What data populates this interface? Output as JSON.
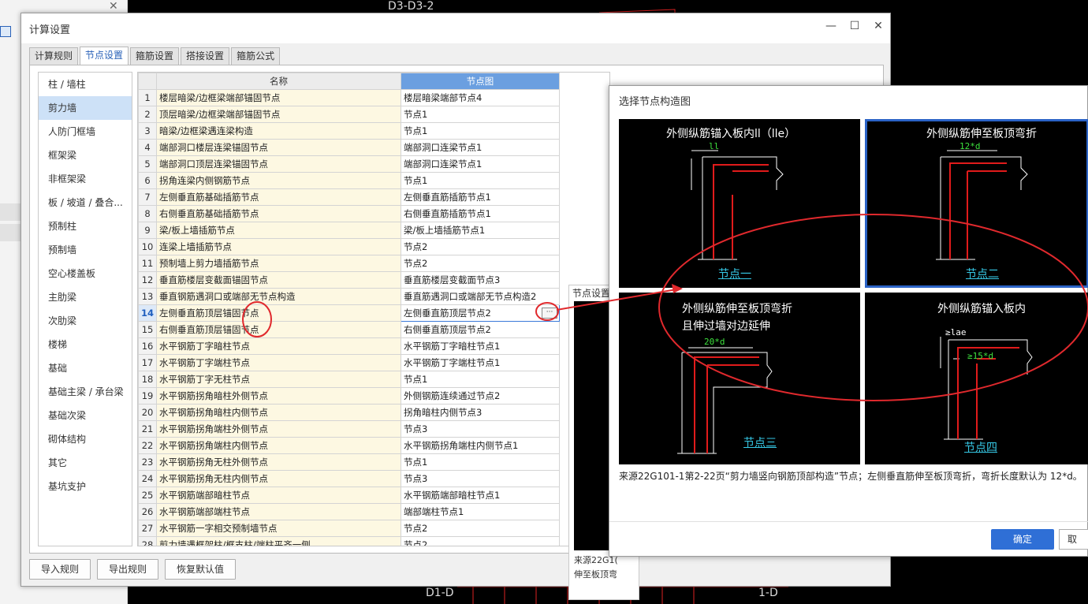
{
  "cad": {
    "label_top": "D3-D3-2",
    "label_bottom_left": "D1-D",
    "label_bottom_right": "1-D"
  },
  "main_dialog": {
    "title": "计算设置",
    "tabs": [
      "计算规则",
      "节点设置",
      "箍筋设置",
      "搭接设置",
      "箍筋公式"
    ],
    "active_tab": "节点设置",
    "categories": [
      "柱 / 墙柱",
      "剪力墙",
      "人防门框墙",
      "框架梁",
      "非框架梁",
      "板 / 坡道 / 叠合...",
      "预制柱",
      "预制墙",
      "空心楼盖板",
      "主肋梁",
      "次肋梁",
      "楼梯",
      "基础",
      "基础主梁 / 承台梁",
      "基础次梁",
      "砌体结构",
      "其它",
      "基坑支护"
    ],
    "selected_category": "剪力墙",
    "table": {
      "col_name": "名称",
      "col_diagram": "节点图",
      "rows": [
        {
          "no": "1",
          "name": "楼层暗梁/边框梁端部锚固节点",
          "value": "楼层暗梁端部节点4"
        },
        {
          "no": "2",
          "name": "顶层暗梁/边框梁端部锚固节点",
          "value": "节点1"
        },
        {
          "no": "3",
          "name": "暗梁/边框梁遇连梁构造",
          "value": "节点1"
        },
        {
          "no": "4",
          "name": "端部洞口楼层连梁锚固节点",
          "value": "端部洞口连梁节点1"
        },
        {
          "no": "5",
          "name": "端部洞口顶层连梁锚固节点",
          "value": "端部洞口连梁节点1"
        },
        {
          "no": "6",
          "name": "拐角连梁内侧钢筋节点",
          "value": "节点1"
        },
        {
          "no": "7",
          "name": "左侧垂直筋基础插筋节点",
          "value": "左侧垂直筋插筋节点1"
        },
        {
          "no": "8",
          "name": "右侧垂直筋基础插筋节点",
          "value": "右侧垂直筋插筋节点1"
        },
        {
          "no": "9",
          "name": "梁/板上墙插筋节点",
          "value": "梁/板上墙插筋节点1"
        },
        {
          "no": "10",
          "name": "连梁上墙插筋节点",
          "value": "节点2"
        },
        {
          "no": "11",
          "name": "预制墙上剪力墙插筋节点",
          "value": "节点2"
        },
        {
          "no": "12",
          "name": "垂直筋楼层变截面锚固节点",
          "value": "垂直筋楼层变截面节点3"
        },
        {
          "no": "13",
          "name": "垂直钢筋遇洞口或端部无节点构造",
          "value": "垂直筋遇洞口或端部无节点构造2"
        },
        {
          "no": "14",
          "name": "左侧垂直筋顶层锚固节点",
          "value": "左侧垂直筋顶层节点2"
        },
        {
          "no": "15",
          "name": "右侧垂直筋顶层锚固节点",
          "value": "右侧垂直筋顶层节点2"
        },
        {
          "no": "16",
          "name": "水平钢筋丁字暗柱节点",
          "value": "水平钢筋丁字暗柱节点1"
        },
        {
          "no": "17",
          "name": "水平钢筋丁字端柱节点",
          "value": "水平钢筋丁字端柱节点1"
        },
        {
          "no": "18",
          "name": "水平钢筋丁字无柱节点",
          "value": "节点1"
        },
        {
          "no": "19",
          "name": "水平钢筋拐角暗柱外侧节点",
          "value": "外侧钢筋连续通过节点2"
        },
        {
          "no": "20",
          "name": "水平钢筋拐角暗柱内侧节点",
          "value": "拐角暗柱内侧节点3"
        },
        {
          "no": "21",
          "name": "水平钢筋拐角端柱外侧节点",
          "value": "节点3"
        },
        {
          "no": "22",
          "name": "水平钢筋拐角端柱内侧节点",
          "value": "水平钢筋拐角端柱内侧节点1"
        },
        {
          "no": "23",
          "name": "水平钢筋拐角无柱外侧节点",
          "value": "节点1"
        },
        {
          "no": "24",
          "name": "水平钢筋拐角无柱内侧节点",
          "value": "节点3"
        },
        {
          "no": "25",
          "name": "水平钢筋端部暗柱节点",
          "value": "水平钢筋端部暗柱节点1"
        },
        {
          "no": "26",
          "name": "水平钢筋端部端柱节点",
          "value": "端部端柱节点1"
        },
        {
          "no": "27",
          "name": "水平钢筋一字相交预制墙节点",
          "value": "节点2"
        },
        {
          "no": "28",
          "name": "剪力墙遇框架柱/框支柱/端柱平齐一侧",
          "value": "节点2"
        }
      ],
      "current_row": "14",
      "ellipsis_label": "···"
    },
    "preview": {
      "header": "节点设置示",
      "footer_line1": "来源22G1(",
      "footer_line2": "伸至板顶弯"
    },
    "buttons": {
      "import": "导入规则",
      "export": "导出规则",
      "restore": "恢复默认值"
    }
  },
  "node_dialog": {
    "title": "选择节点构造图",
    "cells": [
      {
        "title": "外侧纵筋锚入板内ll（lle）",
        "dim": "ll",
        "link": "节点一",
        "selected": false
      },
      {
        "title": "外侧纵筋伸至板顶弯折",
        "dim": "12*d",
        "link": "节点二",
        "selected": true
      },
      {
        "title_line1": "外侧纵筋伸至板顶弯折",
        "title_line2": "且伸过墙对边延伸",
        "dim": "20*d",
        "link": "节点三",
        "selected": false
      },
      {
        "title": "外侧纵筋锚入板内",
        "dim": "≥lae",
        "dim2": "≥15*d",
        "link": "节点四",
        "selected": false
      }
    ],
    "description": "来源22G101-1第2-22页“剪力墙竖向钢筋顶部构造”节点；左侧垂直筋伸至板顶弯折，弯折长度默认为 12*d。",
    "ok": "确定",
    "cancel": "取"
  },
  "colors": {
    "accent": "#2f6fd6",
    "header_highlight": "#6b9fe0",
    "name_cell_bg": "#fdf8e2",
    "rebar_red": "#e11b1b",
    "annotation_red": "#e0292d",
    "link_cyan": "#36c9e6",
    "dim_green": "#3ee23e"
  }
}
